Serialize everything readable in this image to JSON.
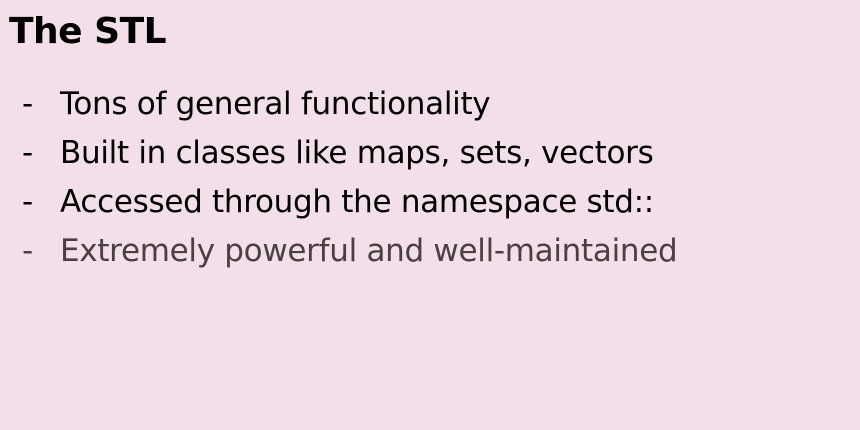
{
  "slide": {
    "title": "The STL",
    "bullets": [
      {
        "marker": "-",
        "text": "Tons of general functionality"
      },
      {
        "marker": "-",
        "text": "Built in classes like maps, sets, vectors"
      },
      {
        "marker": "-",
        "text": "Accessed through the namespace std::"
      },
      {
        "marker": "-",
        "text": "Extremely powerful and well-maintained"
      }
    ]
  },
  "colors": {
    "background": "#f2dfea",
    "text": "#000000",
    "muted_text": "#4a4043"
  }
}
